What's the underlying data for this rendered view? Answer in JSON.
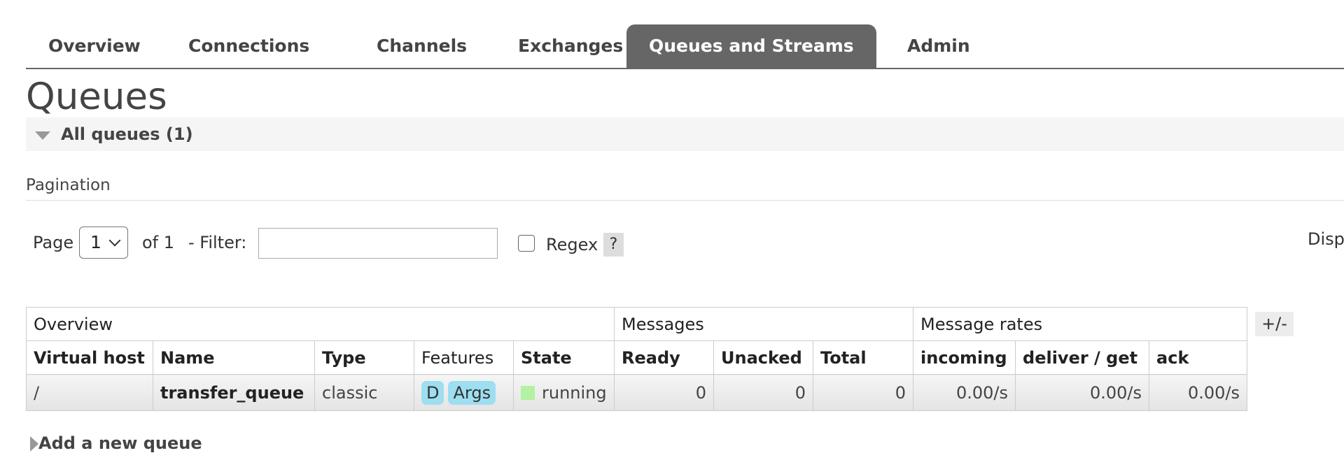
{
  "tabs": [
    {
      "label": "Overview"
    },
    {
      "label": "Connections"
    },
    {
      "label": "Channels"
    },
    {
      "label": "Exchanges"
    },
    {
      "label": "Queues and Streams",
      "active": true
    },
    {
      "label": "Admin"
    }
  ],
  "page_title": "Queues",
  "section": {
    "label": "All queues (1)"
  },
  "pagination": {
    "title": "Pagination",
    "page_label": "Page",
    "page_value": "1",
    "of_label": "of 1",
    "filter_label": "- Filter:",
    "filter_value": "",
    "regex_label": "Regex",
    "help_label": "?",
    "display_label": "Disp"
  },
  "table": {
    "groups": [
      "Overview",
      "Messages",
      "Message rates"
    ],
    "columns": [
      "Virtual host",
      "Name",
      "Type",
      "Features",
      "State",
      "Ready",
      "Unacked",
      "Total",
      "incoming",
      "deliver / get",
      "ack"
    ],
    "rows": [
      {
        "vhost": "/",
        "name": "transfer_queue",
        "type": "classic",
        "features": [
          "D",
          "Args"
        ],
        "state": "running",
        "ready": "0",
        "unacked": "0",
        "total": "0",
        "incoming": "0.00/s",
        "deliver_get": "0.00/s",
        "ack": "0.00/s"
      }
    ],
    "toggle_label": "+/-"
  },
  "add_queue": {
    "label": "Add a new queue"
  },
  "colors": {
    "tab_active": "#666666",
    "state_running": "#b3f2a0",
    "feature_badge": "#9ddef0"
  }
}
